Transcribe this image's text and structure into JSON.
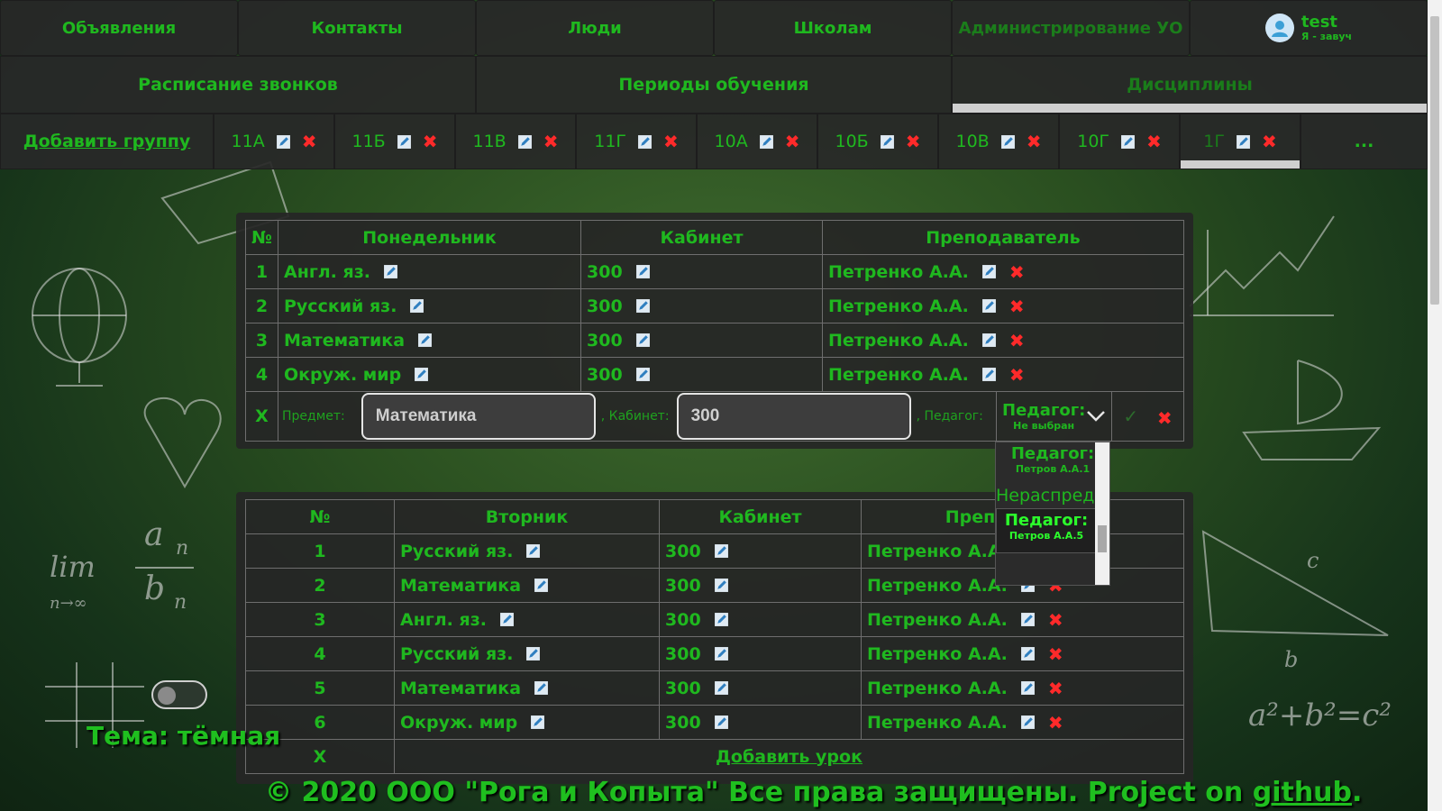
{
  "nav_top": {
    "items": [
      "Объявления",
      "Контакты",
      "Люди",
      "Школам",
      "Администрирование УО"
    ],
    "user": {
      "name": "test",
      "role": "Я - завуч"
    }
  },
  "nav_sub": {
    "items": [
      "Расписание звонков",
      "Периоды обучения",
      "Дисциплины"
    ]
  },
  "groups": {
    "add_label": "Добавить группу",
    "items": [
      "11А",
      "11Б",
      "11В",
      "11Г",
      "10А",
      "10Б",
      "10В",
      "10Г",
      "1Г"
    ],
    "more": "..."
  },
  "monday": {
    "headers": [
      "№",
      "Понедельник",
      "Кабинет",
      "Преподаватель"
    ],
    "rows": [
      {
        "n": "1",
        "subject": "Англ. яз.",
        "room": "300",
        "teacher": "Петренко А.А."
      },
      {
        "n": "2",
        "subject": "Русский яз.",
        "room": "300",
        "teacher": "Петренко А.А."
      },
      {
        "n": "3",
        "subject": "Математика",
        "room": "300",
        "teacher": "Петренко А.А."
      },
      {
        "n": "4",
        "subject": "Окруж. мир",
        "room": "300",
        "teacher": "Петренко А.А."
      }
    ],
    "edit": {
      "marker": "X",
      "subject_label": "Предмет:",
      "subject_value": "Математика",
      "room_label": ", Кабинет:",
      "room_value": "300",
      "teacher_label": ", Педагог:",
      "select_title": "Педагог:",
      "select_sub": "Не выбран"
    }
  },
  "dropdown": {
    "item1_title": "Педагог:",
    "item1_sub": "Петров А.А.1",
    "group_label": "Нераспределённые:",
    "item2_title": "Педагог:",
    "item2_sub": "Петров А.А.5"
  },
  "tuesday": {
    "headers": [
      "№",
      "Вторник",
      "Кабинет",
      "Преподаватель"
    ],
    "rows": [
      {
        "n": "1",
        "subject": "Русский яз.",
        "room": "300",
        "teacher": "Петренко А.А."
      },
      {
        "n": "2",
        "subject": "Математика",
        "room": "300",
        "teacher": "Петренко А.А."
      },
      {
        "n": "3",
        "subject": "Англ. яз.",
        "room": "300",
        "teacher": "Петренко А.А."
      },
      {
        "n": "4",
        "subject": "Русский яз.",
        "room": "300",
        "teacher": "Петренко А.А."
      },
      {
        "n": "5",
        "subject": "Математика",
        "room": "300",
        "teacher": "Петренко А.А."
      },
      {
        "n": "6",
        "subject": "Окруж. мир",
        "room": "300",
        "teacher": "Петренко А.А."
      }
    ],
    "add_marker": "X",
    "add_label": "Добавить урок"
  },
  "theme": {
    "label": "Тема: тёмная"
  },
  "footer": {
    "text": "© 2020 ООО \"Рога и Копыта\" Все права защищены. Project on ",
    "link": "github",
    "end": "."
  },
  "colors": {
    "accent": "#1fb81f",
    "delete": "#ff2a2a",
    "panel": "#262626"
  }
}
